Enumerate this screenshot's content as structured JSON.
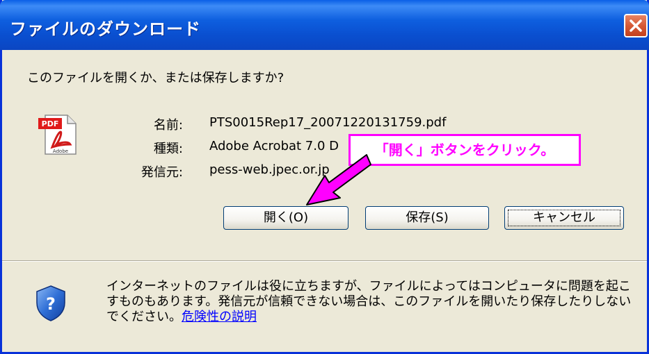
{
  "window": {
    "title": "ファイルのダウンロード"
  },
  "dialog": {
    "question": "このファイルを開くか、または保存しますか?",
    "file_info": {
      "name_label": "名前:",
      "name_value": "PTS0015Rep17_20071220131759.pdf",
      "type_label": "種類:",
      "type_value": "Adobe Acrobat 7.0 D",
      "source_label": "発信元:",
      "source_value": "pess-web.jpec.or.jp"
    },
    "icons": {
      "file": "pdf-file-icon",
      "security": "shield-question-icon",
      "close": "close-icon"
    },
    "buttons": {
      "open": "開く(O)",
      "save": "保存(S)",
      "cancel": "キャンセル"
    },
    "warning": {
      "text": "インターネットのファイルは役に立ちますが、ファイルによってはコンピュータに問題を起こすものもあります。発信元が信頼できない場合は、このファイルを開いたり保存したりしないでください。",
      "link": "危険性の説明"
    }
  },
  "annotation": {
    "text": "「開く」ボタンをクリック。",
    "color": "#ff00ff"
  },
  "colors": {
    "titlebar": "#0a4fd0",
    "frame": "#0831d9",
    "dialog_bg": "#ece9d8",
    "close_button": "#d65a36",
    "link": "#0000ff"
  }
}
